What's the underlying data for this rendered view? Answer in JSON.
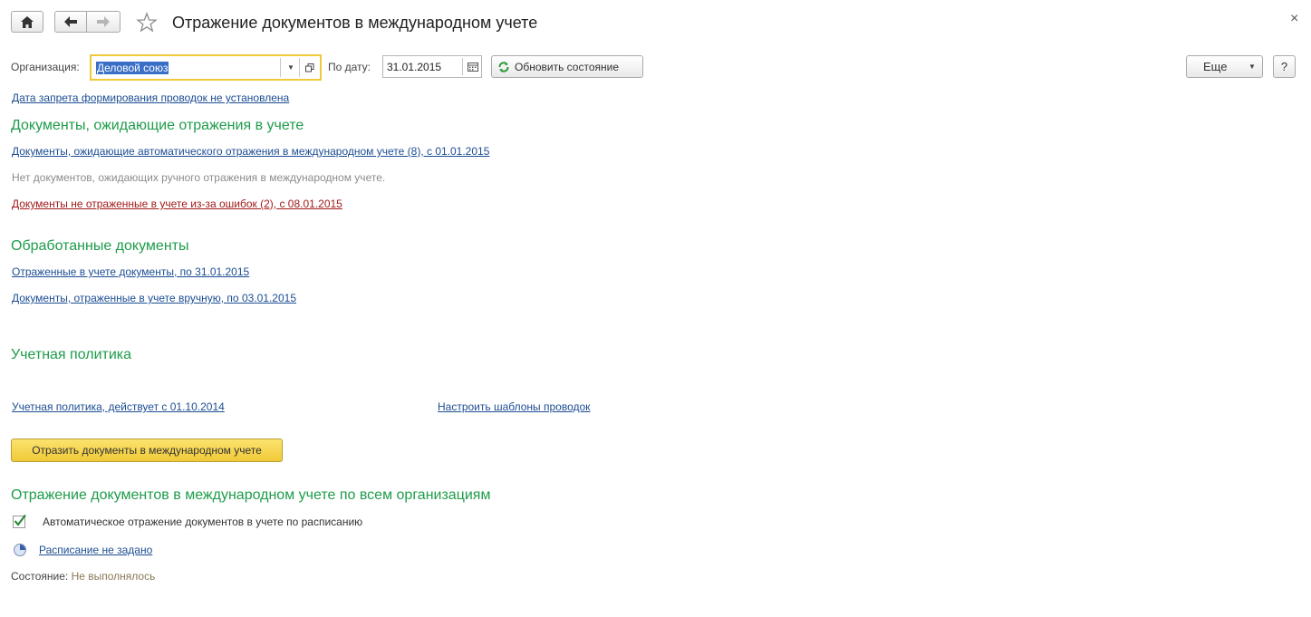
{
  "window": {
    "title": "Отражение документов в международном учете",
    "close_symbol": "×"
  },
  "toolbar": {
    "home_icon": "home-icon",
    "back_icon": "arrow-left-icon",
    "forward_icon": "arrow-right-icon",
    "favorite_icon": "star-icon",
    "more_label": "Еще",
    "help_label": "?"
  },
  "filters": {
    "organization_label": "Организация:",
    "organization_value": "Деловой союз",
    "date_label": "По дату:",
    "date_value": "31.01.2015",
    "refresh_label": "Обновить состояние"
  },
  "links": {
    "closing_date": "Дата запрета формирования проводок не установлена"
  },
  "pending": {
    "heading": "Документы, ожидающие отражения в учете",
    "auto_link": "Документы, ожидающие автоматического отражения в международном учете (8), с 01.01.2015",
    "manual_text": "Нет документов, ожидающих ручного отражения в международном учете.",
    "errors_link": "Документы не отраженные в учете из-за ошибок (2), с 08.01.2015"
  },
  "processed": {
    "heading": "Обработанные документы",
    "reflected_link": "Отраженные в учете документы, по 31.01.2015",
    "manual_link": "Документы, отраженные в учете вручную, по 03.01.2015"
  },
  "policy": {
    "heading": "Учетная политика",
    "policy_link": "Учетная политика, действует с 01.10.2014",
    "templates_link": "Настроить шаблоны проводок",
    "reflect_button": "Отразить документы в международном учете"
  },
  "all_orgs": {
    "heading": "Отражение документов в международном учете по всем организациям",
    "auto_checkbox_label": "Автоматическое отражение документов в учете по расписанию",
    "auto_checked": true,
    "schedule_link": "Расписание не задано",
    "state_label": "Состояние:",
    "state_value": "Не выполнялось"
  },
  "colors": {
    "section_green": "#1e9c4a",
    "link_blue": "#1c4d93",
    "error_red": "#a31a1a",
    "accent_yellow": "#f0c937"
  }
}
